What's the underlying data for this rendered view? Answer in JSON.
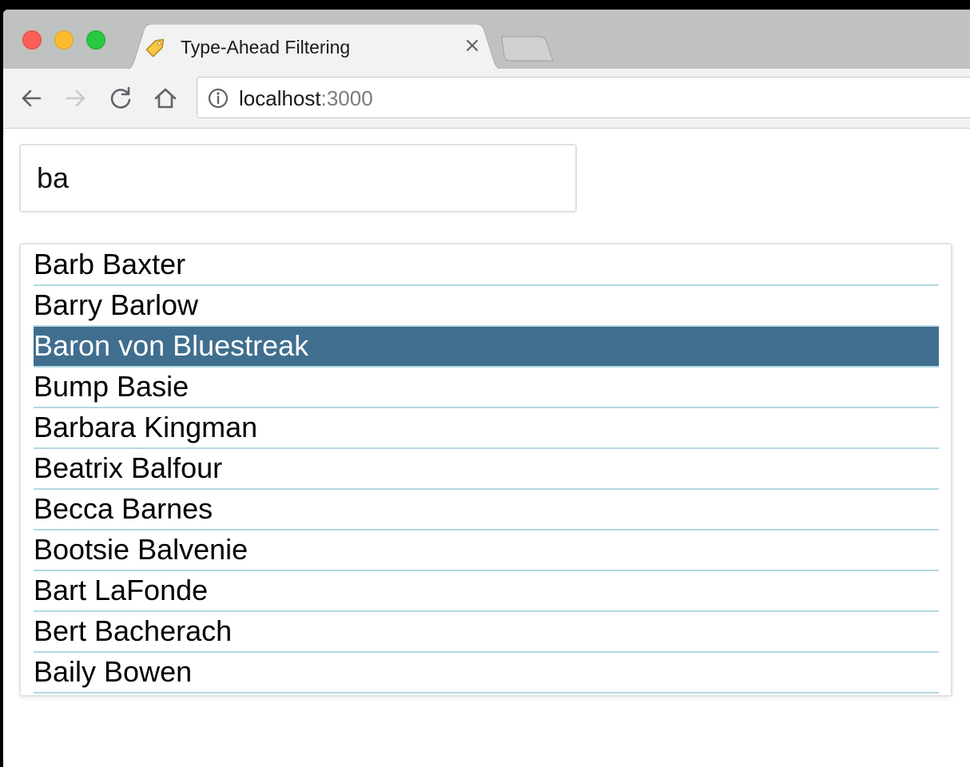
{
  "browser": {
    "tab": {
      "title": "Type-Ahead Filtering",
      "close_glyph": "×",
      "favicon": "tag-icon"
    },
    "address": {
      "host": "localhost",
      "port": ":3000"
    },
    "toolbar_icons": [
      "back-arrow-icon",
      "forward-arrow-icon",
      "reload-icon",
      "home-icon",
      "info-icon"
    ]
  },
  "search": {
    "value": "ba"
  },
  "results": {
    "items": [
      {
        "label": "Barb Baxter",
        "selected": false
      },
      {
        "label": "Barry Barlow",
        "selected": false
      },
      {
        "label": "Baron von Bluestreak",
        "selected": true
      },
      {
        "label": "Bump Basie",
        "selected": false
      },
      {
        "label": "Barbara Kingman",
        "selected": false
      },
      {
        "label": "Beatrix Balfour",
        "selected": false
      },
      {
        "label": "Becca Barnes",
        "selected": false
      },
      {
        "label": "Bootsie Balvenie",
        "selected": false
      },
      {
        "label": "Bart LaFonde",
        "selected": false
      },
      {
        "label": "Bert Bacherach",
        "selected": false
      },
      {
        "label": "Baily Bowen",
        "selected": false
      }
    ],
    "selected_color": "#406e8e",
    "divider_color": "#b3d8e0"
  }
}
